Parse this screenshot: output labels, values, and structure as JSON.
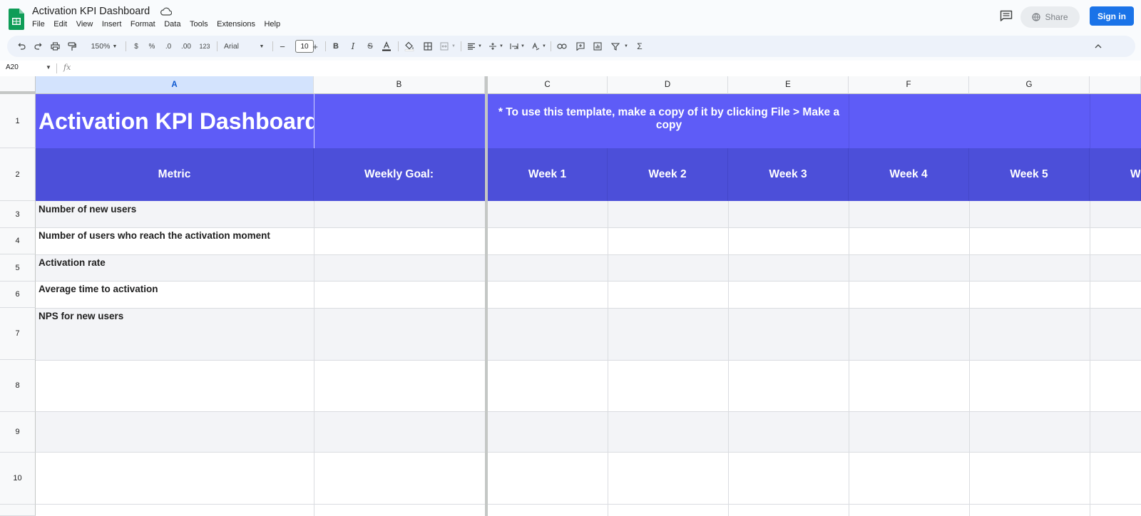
{
  "app": {
    "doc_title": "Activation KPI Dashboard",
    "menu": [
      "File",
      "Edit",
      "View",
      "Insert",
      "Format",
      "Data",
      "Tools",
      "Extensions",
      "Help"
    ],
    "share_label": "Share",
    "signin_label": "Sign in",
    "brand_color": "#0f9d58",
    "accent_color": "#1a73e8"
  },
  "toolbar": {
    "zoom": "150%",
    "currency": "$",
    "percent": "%",
    "decrease_decimal": ".0",
    "increase_decimal": ".00",
    "number_format": "123",
    "font": "Arial",
    "font_size": "10",
    "icons": [
      "undo-icon",
      "redo-icon",
      "print-icon",
      "paint-format-icon",
      "bold-icon",
      "italic-icon",
      "strikethrough-icon",
      "text-color-icon",
      "fill-color-icon",
      "borders-icon",
      "merge-icon",
      "align-icon",
      "valign-icon",
      "wrap-icon",
      "rotate-icon",
      "link-icon",
      "comment-icon",
      "chart-icon",
      "filter-icon",
      "functions-icon",
      "collapse-icon"
    ]
  },
  "formula_bar": {
    "name_box": "A20",
    "fx_label": "fx"
  },
  "sheet": {
    "columns": [
      "A",
      "B",
      "C",
      "D",
      "E",
      "F",
      "G"
    ],
    "rows": [
      "1",
      "2",
      "3",
      "4",
      "5",
      "6",
      "7",
      "8",
      "9",
      "10"
    ],
    "title": "Activation KPI Dashboard",
    "note": "* To use this template, make a copy of it by clicking File > Make a copy",
    "headers": {
      "metric": "Metric",
      "goal": "Weekly Goal:",
      "weeks": [
        "Week 1",
        "Week 2",
        "Week 3",
        "Week 4",
        "Week 5",
        "W"
      ]
    },
    "metrics": [
      "Number of new users",
      "Number of users who reach the activation moment",
      "Activation rate",
      "Average time to activation",
      "NPS for new users"
    ],
    "colors": {
      "title_band": "#5e5cf7",
      "header_band": "#4c4fd9",
      "zebra": "#f3f4f7"
    }
  }
}
